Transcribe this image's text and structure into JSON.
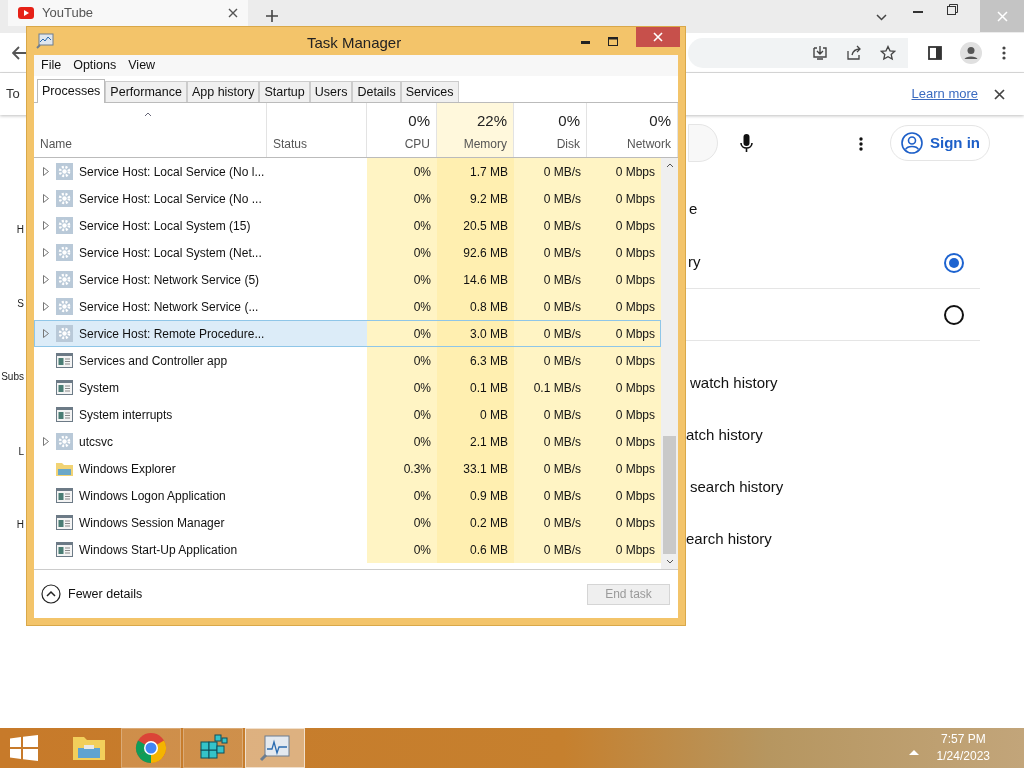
{
  "browser": {
    "tab": {
      "title": "YouTube"
    },
    "infobar": {
      "text": "To",
      "link": "Learn more"
    },
    "sign_in": "Sign in",
    "side_fragments": [
      "H",
      "S",
      "Subs",
      "L",
      "H"
    ],
    "settings_heading": "e",
    "radio_rows": [
      {
        "label": "ry",
        "selected": true
      },
      {
        "selected": false
      }
    ],
    "history_actions": [
      "watch history",
      "atch history",
      "search history",
      "earch history"
    ]
  },
  "task_manager": {
    "title": "Task Manager",
    "menu": [
      "File",
      "Options",
      "View"
    ],
    "tabs": [
      {
        "label": "Processes",
        "selected": true
      },
      {
        "label": "Performance",
        "selected": false
      },
      {
        "label": "App history",
        "selected": false
      },
      {
        "label": "Startup",
        "selected": false
      },
      {
        "label": "Users",
        "selected": false
      },
      {
        "label": "Details",
        "selected": false
      },
      {
        "label": "Services",
        "selected": false
      }
    ],
    "columns": [
      {
        "label": "Name"
      },
      {
        "label": "Status"
      },
      {
        "label": "CPU",
        "total": "0%"
      },
      {
        "label": "Memory",
        "total": "22%"
      },
      {
        "label": "Disk",
        "total": "0%"
      },
      {
        "label": "Network",
        "total": "0%"
      }
    ],
    "rows": [
      {
        "name": "Service Host: Local Service (No l...",
        "kind": "service",
        "expandable": true,
        "selected": false,
        "cpu": "0%",
        "memory": "1.7 MB",
        "disk": "0 MB/s",
        "network": "0 Mbps"
      },
      {
        "name": "Service Host: Local Service (No ...",
        "kind": "service",
        "expandable": true,
        "selected": false,
        "cpu": "0%",
        "memory": "9.2 MB",
        "disk": "0 MB/s",
        "network": "0 Mbps"
      },
      {
        "name": "Service Host: Local System (15)",
        "kind": "service",
        "expandable": true,
        "selected": false,
        "cpu": "0%",
        "memory": "20.5 MB",
        "disk": "0 MB/s",
        "network": "0 Mbps"
      },
      {
        "name": "Service Host: Local System (Net...",
        "kind": "service",
        "expandable": true,
        "selected": false,
        "cpu": "0%",
        "memory": "92.6 MB",
        "disk": "0 MB/s",
        "network": "0 Mbps"
      },
      {
        "name": "Service Host: Network Service (5)",
        "kind": "service",
        "expandable": true,
        "selected": false,
        "cpu": "0%",
        "memory": "14.6 MB",
        "disk": "0 MB/s",
        "network": "0 Mbps"
      },
      {
        "name": "Service Host: Network Service (...",
        "kind": "service",
        "expandable": true,
        "selected": false,
        "cpu": "0%",
        "memory": "0.8 MB",
        "disk": "0 MB/s",
        "network": "0 Mbps"
      },
      {
        "name": "Service Host: Remote Procedure...",
        "kind": "service",
        "expandable": true,
        "selected": true,
        "cpu": "0%",
        "memory": "3.0 MB",
        "disk": "0 MB/s",
        "network": "0 Mbps"
      },
      {
        "name": "Services and Controller app",
        "kind": "app",
        "expandable": false,
        "selected": false,
        "cpu": "0%",
        "memory": "6.3 MB",
        "disk": "0 MB/s",
        "network": "0 Mbps"
      },
      {
        "name": "System",
        "kind": "app",
        "expandable": false,
        "selected": false,
        "cpu": "0%",
        "memory": "0.1 MB",
        "disk": "0.1 MB/s",
        "network": "0 Mbps"
      },
      {
        "name": "System interrupts",
        "kind": "app",
        "expandable": false,
        "selected": false,
        "cpu": "0%",
        "memory": "0 MB",
        "disk": "0 MB/s",
        "network": "0 Mbps"
      },
      {
        "name": "utcsvc",
        "kind": "service",
        "expandable": true,
        "selected": false,
        "cpu": "0%",
        "memory": "2.1 MB",
        "disk": "0 MB/s",
        "network": "0 Mbps"
      },
      {
        "name": "Windows Explorer",
        "kind": "folder",
        "expandable": false,
        "selected": false,
        "cpu": "0.3%",
        "memory": "33.1 MB",
        "disk": "0 MB/s",
        "network": "0 Mbps"
      },
      {
        "name": "Windows Logon Application",
        "kind": "app",
        "expandable": false,
        "selected": false,
        "cpu": "0%",
        "memory": "0.9 MB",
        "disk": "0 MB/s",
        "network": "0 Mbps"
      },
      {
        "name": "Windows Session Manager",
        "kind": "app",
        "expandable": false,
        "selected": false,
        "cpu": "0%",
        "memory": "0.2 MB",
        "disk": "0 MB/s",
        "network": "0 Mbps"
      },
      {
        "name": "Windows Start-Up Application",
        "kind": "app",
        "expandable": false,
        "selected": false,
        "cpu": "0%",
        "memory": "0.6 MB",
        "disk": "0 MB/s",
        "network": "0 Mbps"
      }
    ],
    "fewer_details": "Fewer details",
    "end_task": {
      "label": "End task",
      "disabled": true
    }
  },
  "taskbar": {
    "apps": [
      {
        "kind": "explorer",
        "selected": false
      },
      {
        "kind": "chrome",
        "selected": false
      },
      {
        "kind": "cubes",
        "selected": false
      },
      {
        "kind": "taskmgr",
        "selected": true
      }
    ],
    "time": "7:57 PM",
    "date": "1/24/2023"
  }
}
